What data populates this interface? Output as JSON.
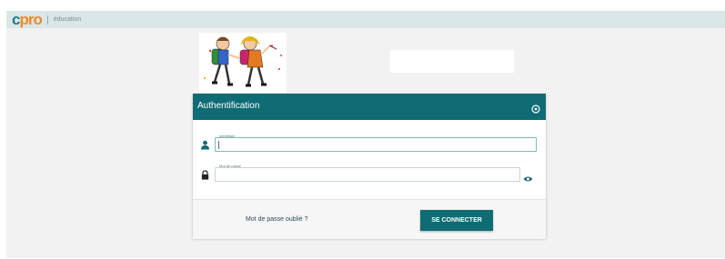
{
  "brand": {
    "logo_prefix": "c",
    "logo_rest": "pro",
    "subtitle": "éducation"
  },
  "login": {
    "title": "Authentification",
    "username_label": "Identifiant",
    "username_value": "",
    "password_label": "Mot de passe",
    "password_value": "",
    "forgot_label": "Mot de passe oublié ?",
    "connect_label": "SE CONNECTER"
  },
  "colors": {
    "accent": "#0f6b74",
    "brand_orange": "#f08a24",
    "topbar": "#dbe6e8"
  },
  "icons": [
    "help-icon",
    "user-icon",
    "lock-icon",
    "eye-icon"
  ]
}
